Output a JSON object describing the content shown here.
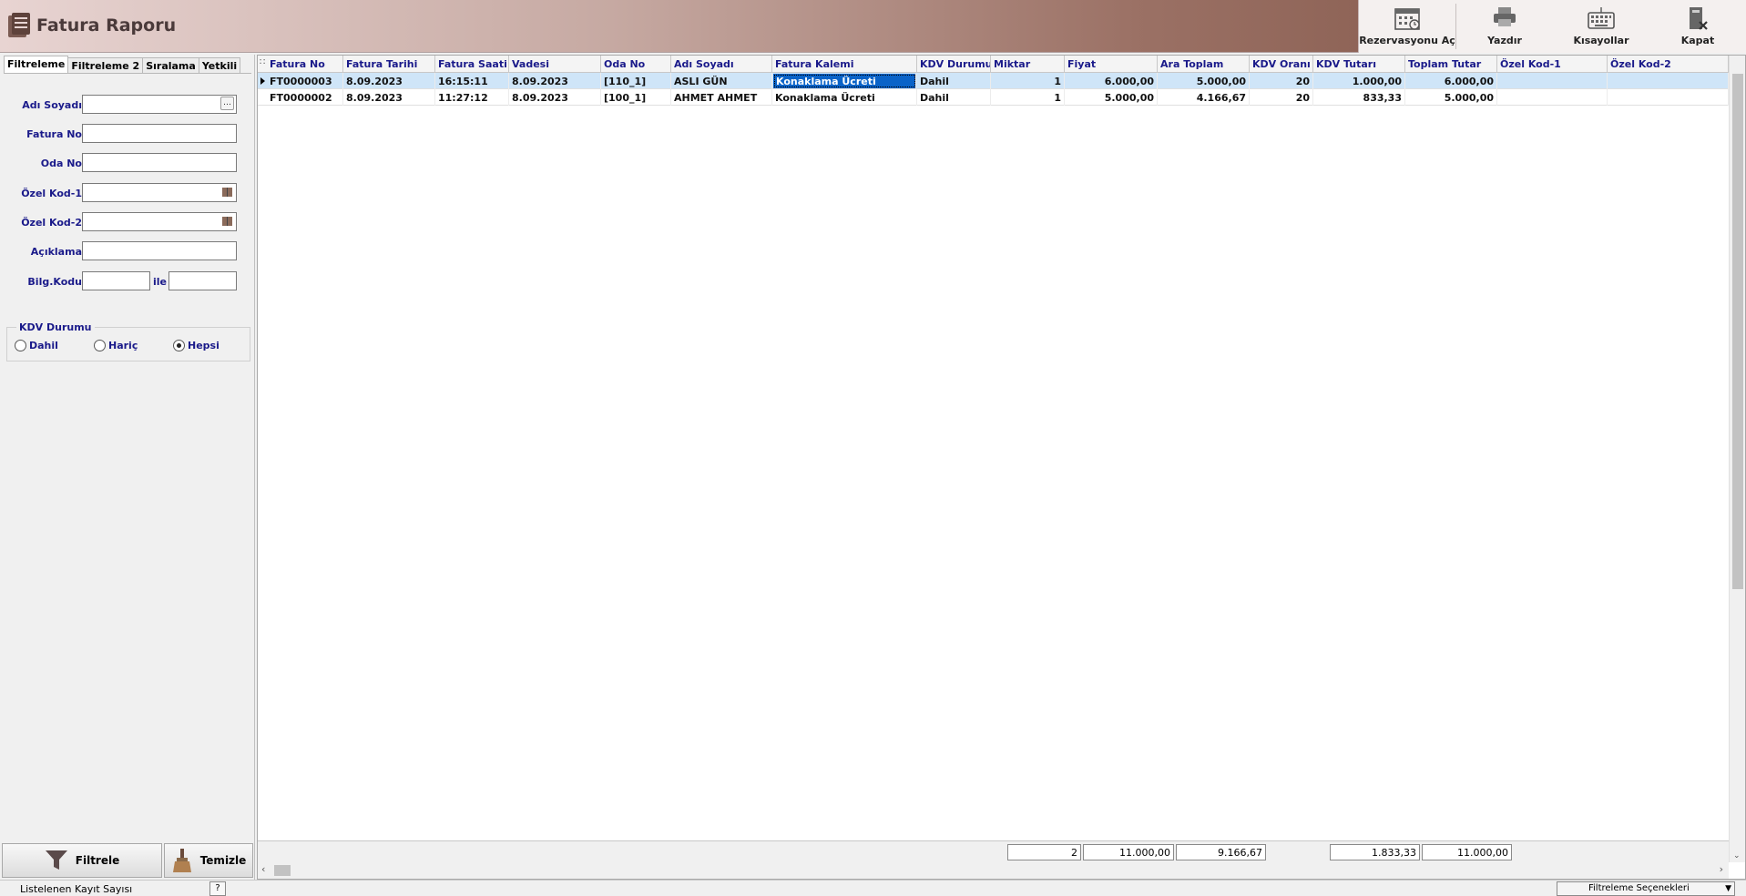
{
  "window": {
    "title": "Fatura Raporu"
  },
  "toolbar": {
    "items": [
      {
        "label": "Rezervasyonu Aç"
      },
      {
        "label": "Yazdır"
      },
      {
        "label": "Kısayollar"
      },
      {
        "label": "Kapat"
      }
    ]
  },
  "tabs": [
    {
      "label": "Filtreleme"
    },
    {
      "label": "Filtreleme 2"
    },
    {
      "label": "Sıralama"
    },
    {
      "label": "Yetkili"
    }
  ],
  "filters": {
    "adi_soyadi": {
      "label": "Adı Soyadı",
      "value": ""
    },
    "fatura_no": {
      "label": "Fatura No",
      "value": ""
    },
    "oda_no": {
      "label": "Oda No",
      "value": ""
    },
    "ozel_kod_1": {
      "label": "Özel Kod-1",
      "value": ""
    },
    "ozel_kod_2": {
      "label": "Özel Kod-2",
      "value": ""
    },
    "aciklama": {
      "label": "Açıklama",
      "value": ""
    },
    "bilg_kodu": {
      "label": "Bilg.Kodu",
      "from": "",
      "to": "",
      "joiner": "ile"
    },
    "kdv_durumu": {
      "title": "KDV Durumu",
      "options": [
        "Dahil",
        "Hariç",
        "Hepsi"
      ],
      "selected": "Hepsi"
    }
  },
  "buttons": {
    "filter": "Filtrele",
    "clear": "Temizle"
  },
  "grid": {
    "columns": [
      "Fatura No",
      "Fatura Tarihi",
      "Fatura Saati",
      "Vadesi",
      "Oda No",
      "Adı Soyadı",
      "Fatura Kalemi",
      "KDV Durumu",
      "Miktar",
      "Fiyat",
      "Ara Toplam",
      "KDV Oranı",
      "KDV Tutarı",
      "Toplam Tutar",
      "Özel Kod-1",
      "Özel Kod-2"
    ],
    "rows": [
      [
        "FT0000003",
        "8.09.2023",
        "16:15:11",
        "8.09.2023",
        "[110_1]",
        "ASLI GÜN",
        "Konaklama Ücreti",
        "Dahil",
        "1",
        "6.000,00",
        "5.000,00",
        "20",
        "1.000,00",
        "6.000,00",
        "",
        ""
      ],
      [
        "FT0000002",
        "8.09.2023",
        "11:27:12",
        "8.09.2023",
        "[100_1]",
        "AHMET AHMET",
        "Konaklama Ücreti",
        "Dahil",
        "1",
        "5.000,00",
        "4.166,67",
        "20",
        "833,33",
        "5.000,00",
        "",
        ""
      ]
    ],
    "totals": {
      "miktar": "2",
      "fiyat": "11.000,00",
      "ara_toplam": "9.166,67",
      "kdv_tutari": "1.833,33",
      "toplam_tutar": "11.000,00"
    }
  },
  "status": {
    "record_count_label": "Listelenen Kayıt Sayısı",
    "help": "?",
    "filter_options": "Filtreleme Seçenekleri"
  }
}
